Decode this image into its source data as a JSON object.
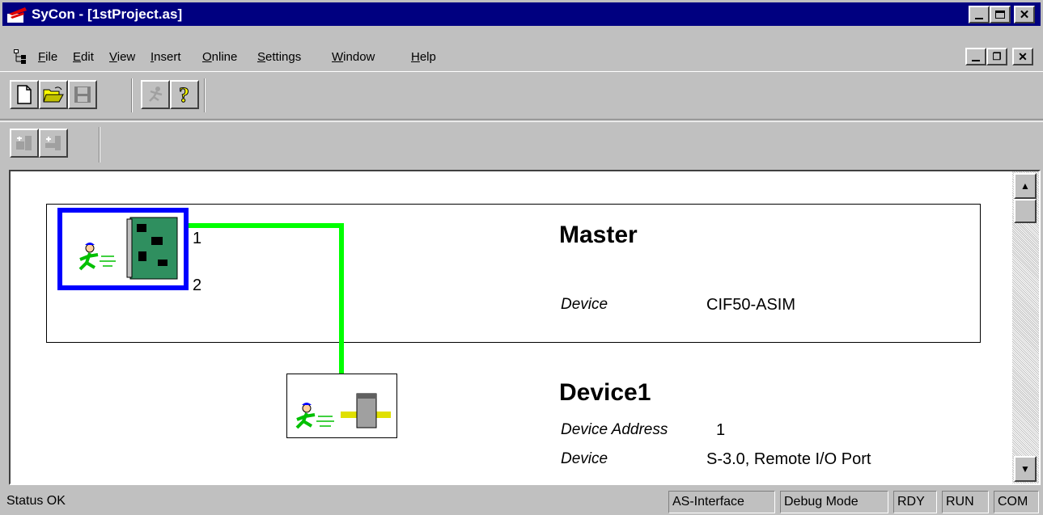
{
  "window": {
    "title": "SyCon - [1stProject.as]"
  },
  "menu": {
    "items": [
      {
        "key": "F",
        "rest": "ile"
      },
      {
        "key": "E",
        "rest": "dit"
      },
      {
        "key": "V",
        "rest": "iew"
      },
      {
        "key": "I",
        "rest": "nsert"
      },
      {
        "key": "O",
        "rest": "nline"
      },
      {
        "key": "S",
        "rest": "ettings"
      },
      {
        "key": "W",
        "rest": "indow"
      },
      {
        "key": "H",
        "rest": "elp"
      }
    ]
  },
  "toolbar": {
    "icons": [
      "new-file-icon",
      "open-folder-icon",
      "save-disk-icon",
      "run-icon",
      "help-icon"
    ]
  },
  "network": {
    "master": {
      "heading": "Master",
      "device_label": "Device",
      "device_value": "CIF50-ASIM",
      "port1": "1",
      "port2": "2"
    },
    "device1": {
      "heading": "Device1",
      "address_label": "Device Address",
      "address_value": "1",
      "device_label": "Device",
      "device_value": "S-3.0, Remote I/O Port"
    },
    "line_color": "#00ff00",
    "selection_color": "#0000ff"
  },
  "status": {
    "text": "Status OK",
    "bus": "AS-Interface",
    "mode": "Debug Mode",
    "rdy": "RDY",
    "run": "RUN",
    "com": "COM"
  }
}
